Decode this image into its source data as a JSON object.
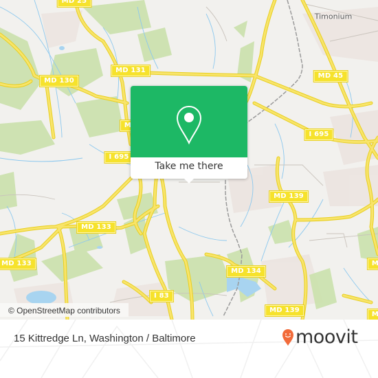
{
  "map": {
    "road_labels": [
      {
        "id": "md25",
        "text": "MD 25"
      },
      {
        "id": "md131",
        "text": "MD 131"
      },
      {
        "id": "md130",
        "text": "MD 130"
      },
      {
        "id": "md45",
        "text": "MD 45"
      },
      {
        "id": "i695_east",
        "text": "I 695"
      },
      {
        "id": "i695_west",
        "text": "I 695"
      },
      {
        "id": "md133_center",
        "text": "MD 133"
      },
      {
        "id": "md133_west",
        "text": "MD 133"
      },
      {
        "id": "md139_north",
        "text": "MD 139"
      },
      {
        "id": "md134",
        "text": "MD 134"
      },
      {
        "id": "i83",
        "text": "I 83"
      },
      {
        "id": "md139_south",
        "text": "MD 139"
      },
      {
        "id": "md_partial_right",
        "text": "M"
      },
      {
        "id": "md_partial_left",
        "text": "M"
      },
      {
        "id": "md_partial_right_mid",
        "text": "M"
      }
    ],
    "place_labels": [
      {
        "id": "timonium",
        "text": "Timonium"
      }
    ],
    "colors": {
      "background": "#f2f1ee",
      "park": "#c8e0a8",
      "water": "#a8d4f0",
      "road_major": "#f6e22c",
      "stream": "#8cc8ee",
      "railway": "#999999"
    }
  },
  "attribution": {
    "text": "© OpenStreetMap contributors"
  },
  "popup": {
    "action_label": "Take me there",
    "accent_color": "#1db865",
    "icon": "map-pin-icon"
  },
  "footer": {
    "address": "15 Kittredge Ln, Washington / Baltimore",
    "brand": "moovit",
    "brand_color": "#f26b3a"
  }
}
